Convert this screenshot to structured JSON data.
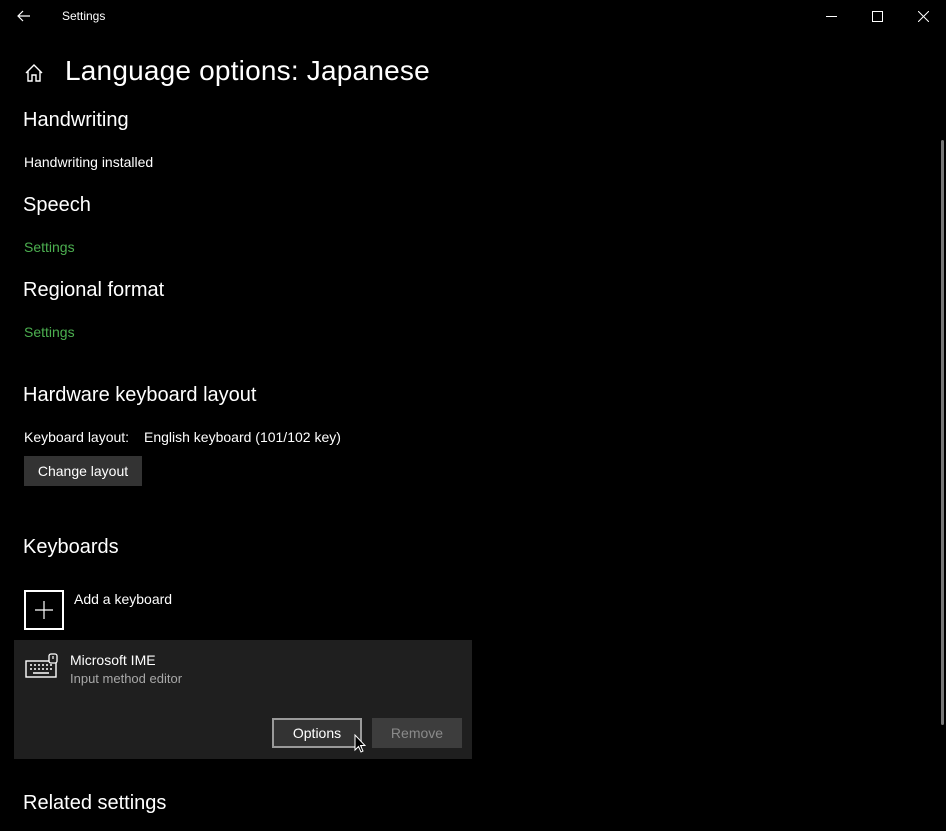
{
  "window": {
    "title": "Settings"
  },
  "page": {
    "title": "Language options: Japanese"
  },
  "handwriting": {
    "heading": "Handwriting",
    "status": "Handwriting installed"
  },
  "speech": {
    "heading": "Speech",
    "link": "Settings"
  },
  "regional": {
    "heading": "Regional format",
    "link": "Settings"
  },
  "hardware": {
    "heading": "Hardware keyboard layout",
    "layout_label": "Keyboard layout:",
    "layout_value": "English keyboard (101/102 key)",
    "change_button": "Change layout"
  },
  "keyboards": {
    "heading": "Keyboards",
    "add_label": "Add a keyboard",
    "items": [
      {
        "name": "Microsoft IME",
        "description": "Input method editor",
        "options_label": "Options",
        "remove_label": "Remove"
      }
    ]
  },
  "related": {
    "heading": "Related settings"
  },
  "colors": {
    "accent_link": "#4caf50",
    "background": "#000000",
    "panel": "#1f1f1f"
  }
}
